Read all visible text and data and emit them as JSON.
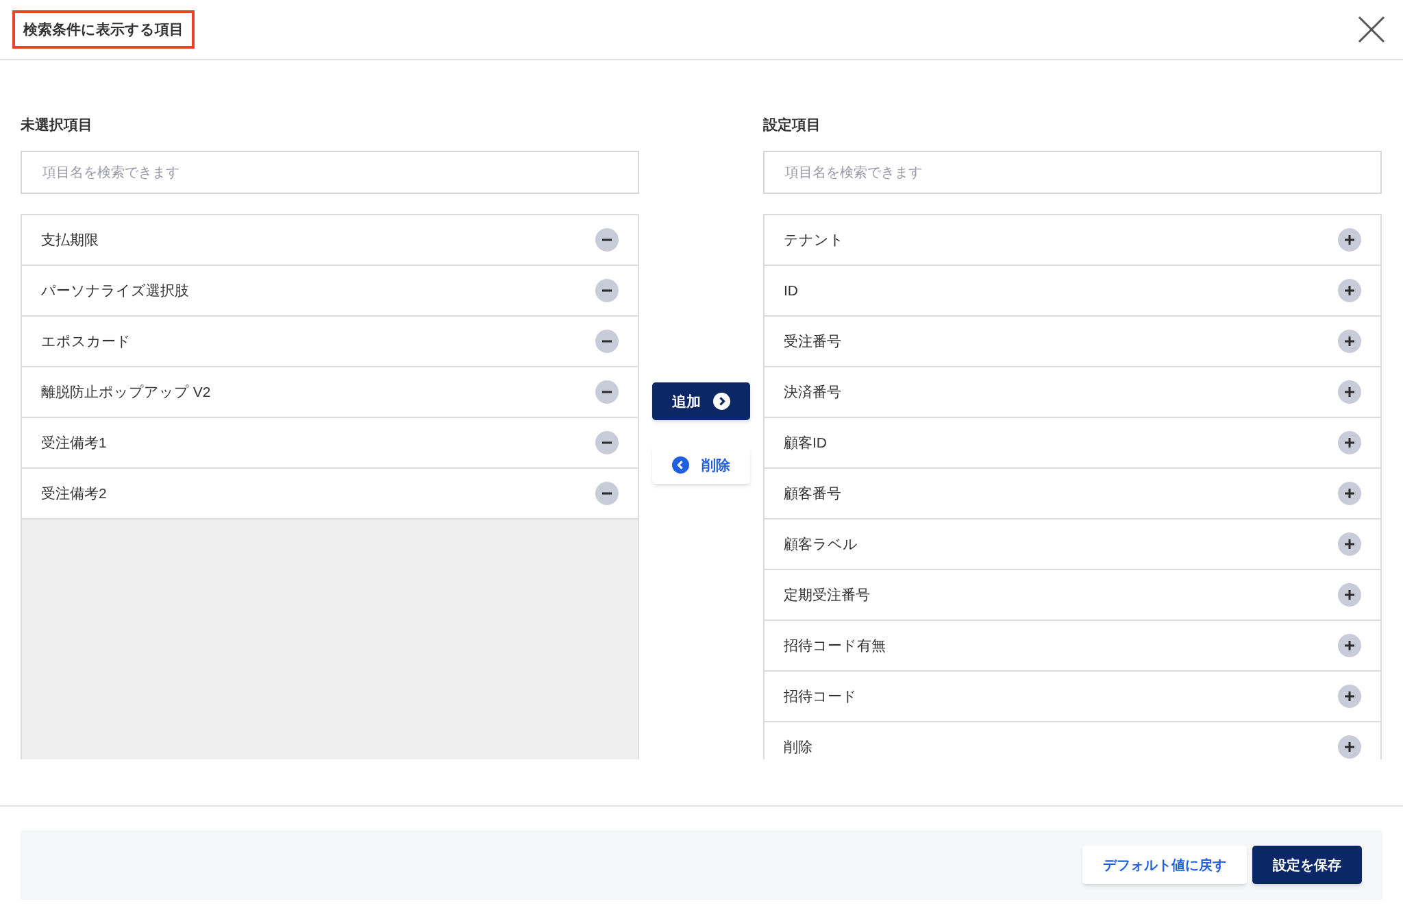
{
  "dialog": {
    "title": "検索条件に表示する項目",
    "title_highlighted": true
  },
  "unselected": {
    "heading": "未選択項目",
    "search": {
      "placeholder": "項目名を検索できます"
    },
    "kind": "remove",
    "items": [
      {
        "label": "支払期限"
      },
      {
        "label": "パーソナライズ選択肢"
      },
      {
        "label": "エポスカード"
      },
      {
        "label": "離脱防止ポップアップ V2"
      },
      {
        "label": "受注備考1"
      },
      {
        "label": "受注備考2"
      }
    ]
  },
  "transfer_buttons": [
    {
      "label": "追加",
      "kind": "add"
    },
    {
      "label": "削除",
      "kind": "remove"
    }
  ],
  "selected": {
    "heading": "設定項目",
    "search": {
      "placeholder": "項目名を検索できます"
    },
    "kind": "add",
    "items": [
      {
        "label": "テナント"
      },
      {
        "label": "ID"
      },
      {
        "label": "受注番号"
      },
      {
        "label": "決済番号"
      },
      {
        "label": "顧客ID"
      },
      {
        "label": "顧客番号"
      },
      {
        "label": "顧客ラベル"
      },
      {
        "label": "定期受注番号"
      },
      {
        "label": "招待コード有無"
      },
      {
        "label": "招待コード"
      },
      {
        "label": "削除"
      }
    ]
  },
  "footer": {
    "buttons": [
      {
        "label": "デフォルト値に戻す",
        "kind": "secondary"
      },
      {
        "label": "設定を保存",
        "kind": "primary"
      }
    ]
  }
}
